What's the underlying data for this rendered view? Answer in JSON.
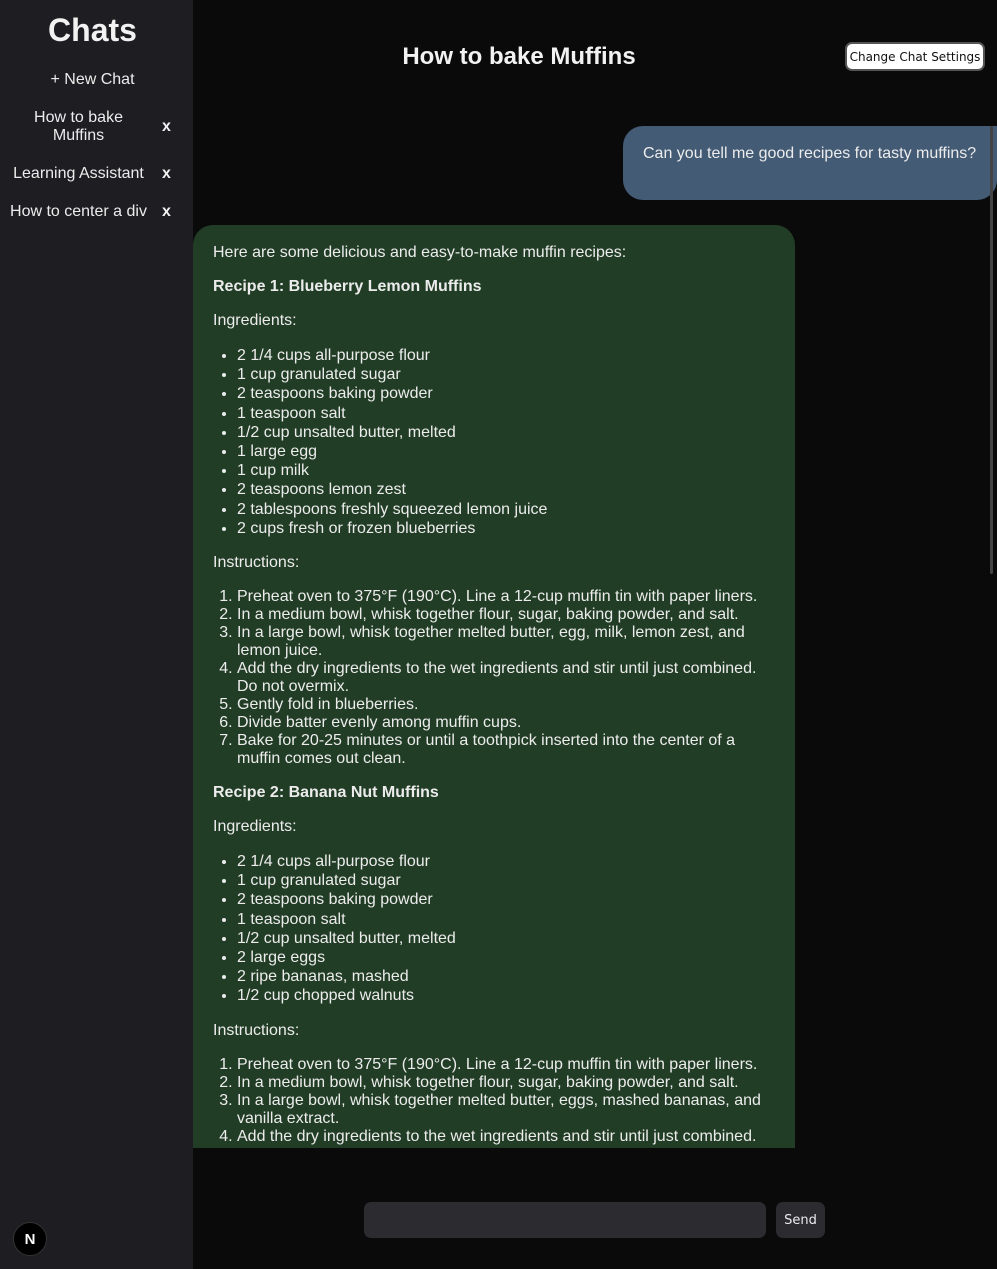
{
  "sidebar": {
    "title": "Chats",
    "new_chat_label": "+ New Chat",
    "chats": [
      {
        "label": "How to bake Muffins",
        "close": "x"
      },
      {
        "label": "Learning Assistant",
        "close": "x"
      },
      {
        "label": "How to center a div",
        "close": "x"
      }
    ],
    "logo_letter": "N"
  },
  "header": {
    "title": "How to bake Muffins",
    "settings_label": "Change Chat Settings"
  },
  "messages": {
    "user": "Can you tell me good recipes for tasty muffins?",
    "assistant": {
      "intro": "Here are some delicious and easy-to-make muffin recipes:",
      "recipes": [
        {
          "title": "Recipe 1: Blueberry Lemon Muffins",
          "ingredients_label": "Ingredients:",
          "ingredients": [
            "2 1/4 cups all-purpose flour",
            "1 cup granulated sugar",
            "2 teaspoons baking powder",
            "1 teaspoon salt",
            "1/2 cup unsalted butter, melted",
            "1 large egg",
            "1 cup milk",
            "2 teaspoons lemon zest",
            "2 tablespoons freshly squeezed lemon juice",
            "2 cups fresh or frozen blueberries"
          ],
          "instructions_label": "Instructions:",
          "instructions": [
            "Preheat oven to 375°F (190°C). Line a 12-cup muffin tin with paper liners.",
            "In a medium bowl, whisk together flour, sugar, baking powder, and salt.",
            "In a large bowl, whisk together melted butter, egg, milk, lemon zest, and lemon juice.",
            "Add the dry ingredients to the wet ingredients and stir until just combined. Do not overmix.",
            "Gently fold in blueberries.",
            "Divide batter evenly among muffin cups.",
            "Bake for 20-25 minutes or until a toothpick inserted into the center of a muffin comes out clean."
          ]
        },
        {
          "title": "Recipe 2: Banana Nut Muffins",
          "ingredients_label": "Ingredients:",
          "ingredients": [
            "2 1/4 cups all-purpose flour",
            "1 cup granulated sugar",
            "2 teaspoons baking powder",
            "1 teaspoon salt",
            "1/2 cup unsalted butter, melted",
            "2 large eggs",
            "2 ripe bananas, mashed",
            "1/2 cup chopped walnuts"
          ],
          "instructions_label": "Instructions:",
          "instructions": [
            "Preheat oven to 375°F (190°C). Line a 12-cup muffin tin with paper liners.",
            "In a medium bowl, whisk together flour, sugar, baking powder, and salt.",
            "In a large bowl, whisk together melted butter, eggs, mashed bananas, and vanilla extract.",
            "Add the dry ingredients to the wet ingredients and stir until just combined."
          ]
        }
      ]
    }
  },
  "composer": {
    "input_value": "",
    "send_label": "Send"
  },
  "colors": {
    "sidebar_bg": "#1e1e22",
    "main_bg": "#0a0a0b",
    "user_bubble": "#445b75",
    "assistant_bubble": "#223d26"
  }
}
